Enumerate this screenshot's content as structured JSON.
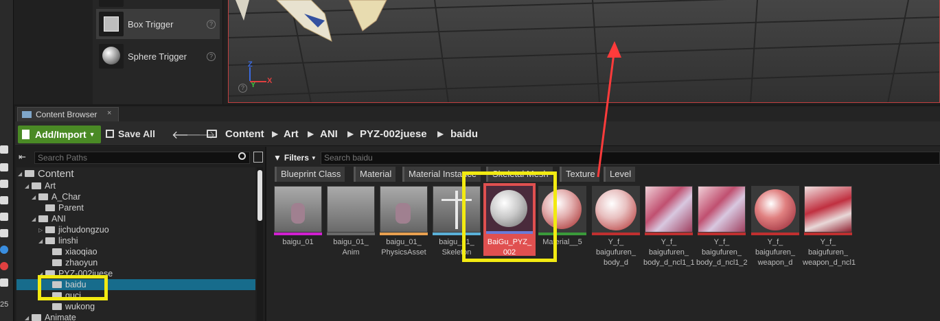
{
  "place_list": {
    "items": [
      {
        "label": "Box Trigger",
        "help": "?"
      },
      {
        "label": "Sphere Trigger",
        "help": "?"
      }
    ]
  },
  "viewport": {
    "axis_z": "Z",
    "axis_y": "Y",
    "axis_x": "X",
    "help": "?"
  },
  "content_browser": {
    "tab_label": "Content Browser",
    "tab_close": "×",
    "add_import": "Add/Import",
    "save_all": "Save All",
    "breadcrumb": [
      "Content",
      "Art",
      "ANI",
      "PYZ-002juese",
      "baidu"
    ],
    "path_search_placeholder": "Search Paths",
    "filters_label": "Filters",
    "asset_search_placeholder": "Search baidu",
    "filter_chips": [
      "Blueprint Class",
      "Material",
      "Material Instance",
      "Skeletal Mesh",
      "Texture",
      "Level"
    ],
    "tree": [
      {
        "label": "Content",
        "depth": 0,
        "expanded": true,
        "big": true
      },
      {
        "label": "Art",
        "depth": 1,
        "expanded": true
      },
      {
        "label": "A_Char",
        "depth": 2,
        "expanded": true
      },
      {
        "label": "Parent",
        "depth": 3
      },
      {
        "label": "ANI",
        "depth": 2,
        "expanded": true
      },
      {
        "label": "jichudongzuo",
        "depth": 3,
        "collapsed": true
      },
      {
        "label": "linshi",
        "depth": 3,
        "expanded": true
      },
      {
        "label": "xiaoqiao",
        "depth": 4
      },
      {
        "label": "zhaoyun",
        "depth": 4
      },
      {
        "label": "PYZ-002juese",
        "depth": 3,
        "expanded": true
      },
      {
        "label": "baidu",
        "depth": 4,
        "selected": true
      },
      {
        "label": "guci",
        "depth": 4
      },
      {
        "label": "wukong",
        "depth": 4
      },
      {
        "label": "Animate",
        "depth": 1,
        "expanded": true
      }
    ],
    "assets": [
      {
        "label": "baigu_01",
        "type": "skeletal-mesh",
        "bar": "#d020d0"
      },
      {
        "label": "baigu_01_ Anim",
        "type": "animation",
        "bar": "#6a6a6a"
      },
      {
        "label": "baigu_01_ PhysicsAsset",
        "type": "physics-asset",
        "bar": "#e8a050"
      },
      {
        "label": "baigu_01_ Skeleton",
        "type": "skeleton",
        "bar": "#5ab0d8"
      },
      {
        "label": "BaiGu_PYZ_ 002",
        "type": "material",
        "bar": "#6a7ad8",
        "selected": true
      },
      {
        "label": "Material__5",
        "type": "material",
        "bar": "#3a9a3a"
      },
      {
        "label": "Y_f_ baigufuren_ body_d",
        "type": "texture",
        "bar": "#c03030"
      },
      {
        "label": "Y_f_ baigufuren_ body_d_ncl1_1",
        "type": "texture",
        "bar": "#c03030"
      },
      {
        "label": "Y_f_ baigufuren_ body_d_ncl1_2",
        "type": "texture",
        "bar": "#c03030"
      },
      {
        "label": "Y_f_ baigufuren_ weapon_d",
        "type": "texture",
        "bar": "#c03030"
      },
      {
        "label": "Y_f_ baigufuren_ weapon_d_ncl1",
        "type": "texture",
        "bar": "#c03030"
      }
    ]
  },
  "left_strip_text": [
    "25"
  ],
  "colors": {
    "highlight": "#f2ea12",
    "selection": "#176c8c",
    "arrow": "#ff3b3b",
    "add_button": "#4a8a25"
  }
}
